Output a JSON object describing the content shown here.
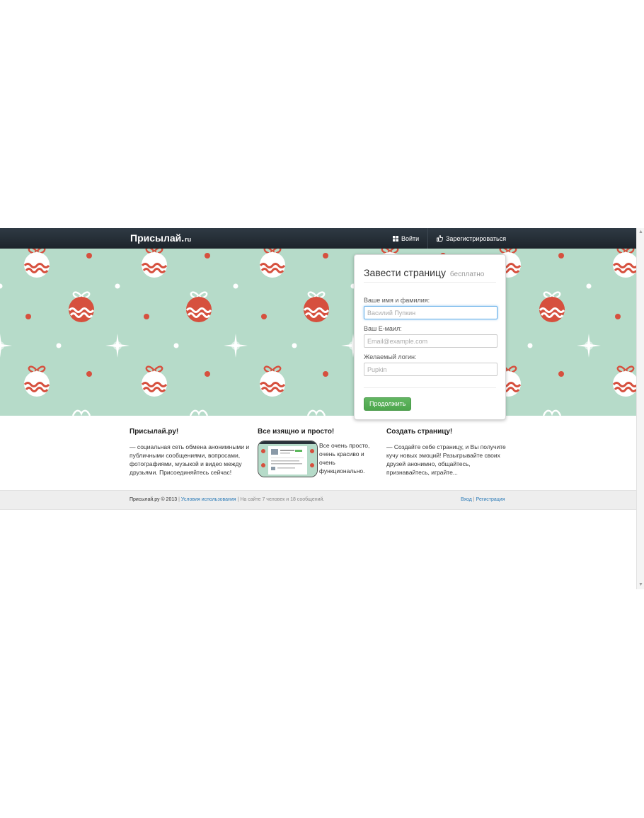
{
  "navbar": {
    "brand": "Присылай.",
    "brand_tld": "ru",
    "login": "Войти",
    "register": "Зарегистрироваться"
  },
  "signup": {
    "title": "Завести страницу",
    "title_suffix": "бесплатно",
    "name_label": "Ваше имя и фамилия:",
    "name_placeholder": "Василий Пупкин",
    "email_label": "Ваш E-маил:",
    "email_placeholder": "Email@example.com",
    "login_label": "Желаемый логин:",
    "login_placeholder": "Pupkin",
    "submit": "Продолжить"
  },
  "features": [
    {
      "title": "Присылай.ру!",
      "text": "— социальная сеть обмена анонимными и публичными сообщениями, вопросами, фотографиями, музыкой и видео между друзьями. Присоединяйтесь сейчас!"
    },
    {
      "title": "Все изящно и просто!",
      "text": "Все очень просто, очень красиво и очень функционально."
    },
    {
      "title": "Создать страницу!",
      "text": "— Создайте себе страницу, и Вы получите кучу новых эмоций! Разыгрывайте своих друзей анонимно, общайтесь, признавайтесь, играйте..."
    }
  ],
  "footer": {
    "copyright": "Присылай.ру © 2013",
    "sep": "|",
    "terms": "Условия использования",
    "stats": "На сайте 7 человек и 18 сообщений.",
    "login": "Вход",
    "register": "Регистрация"
  },
  "colors": {
    "navbar": "#1d242b",
    "hero_bg": "#b6dbc9",
    "ornament_red": "#d6503e",
    "button_green": "#5cb85c",
    "link": "#2a7ab7"
  },
  "icons": [
    "grid-icon",
    "thumbs-up-icon",
    "ornament-icon",
    "sparkle-icon"
  ]
}
